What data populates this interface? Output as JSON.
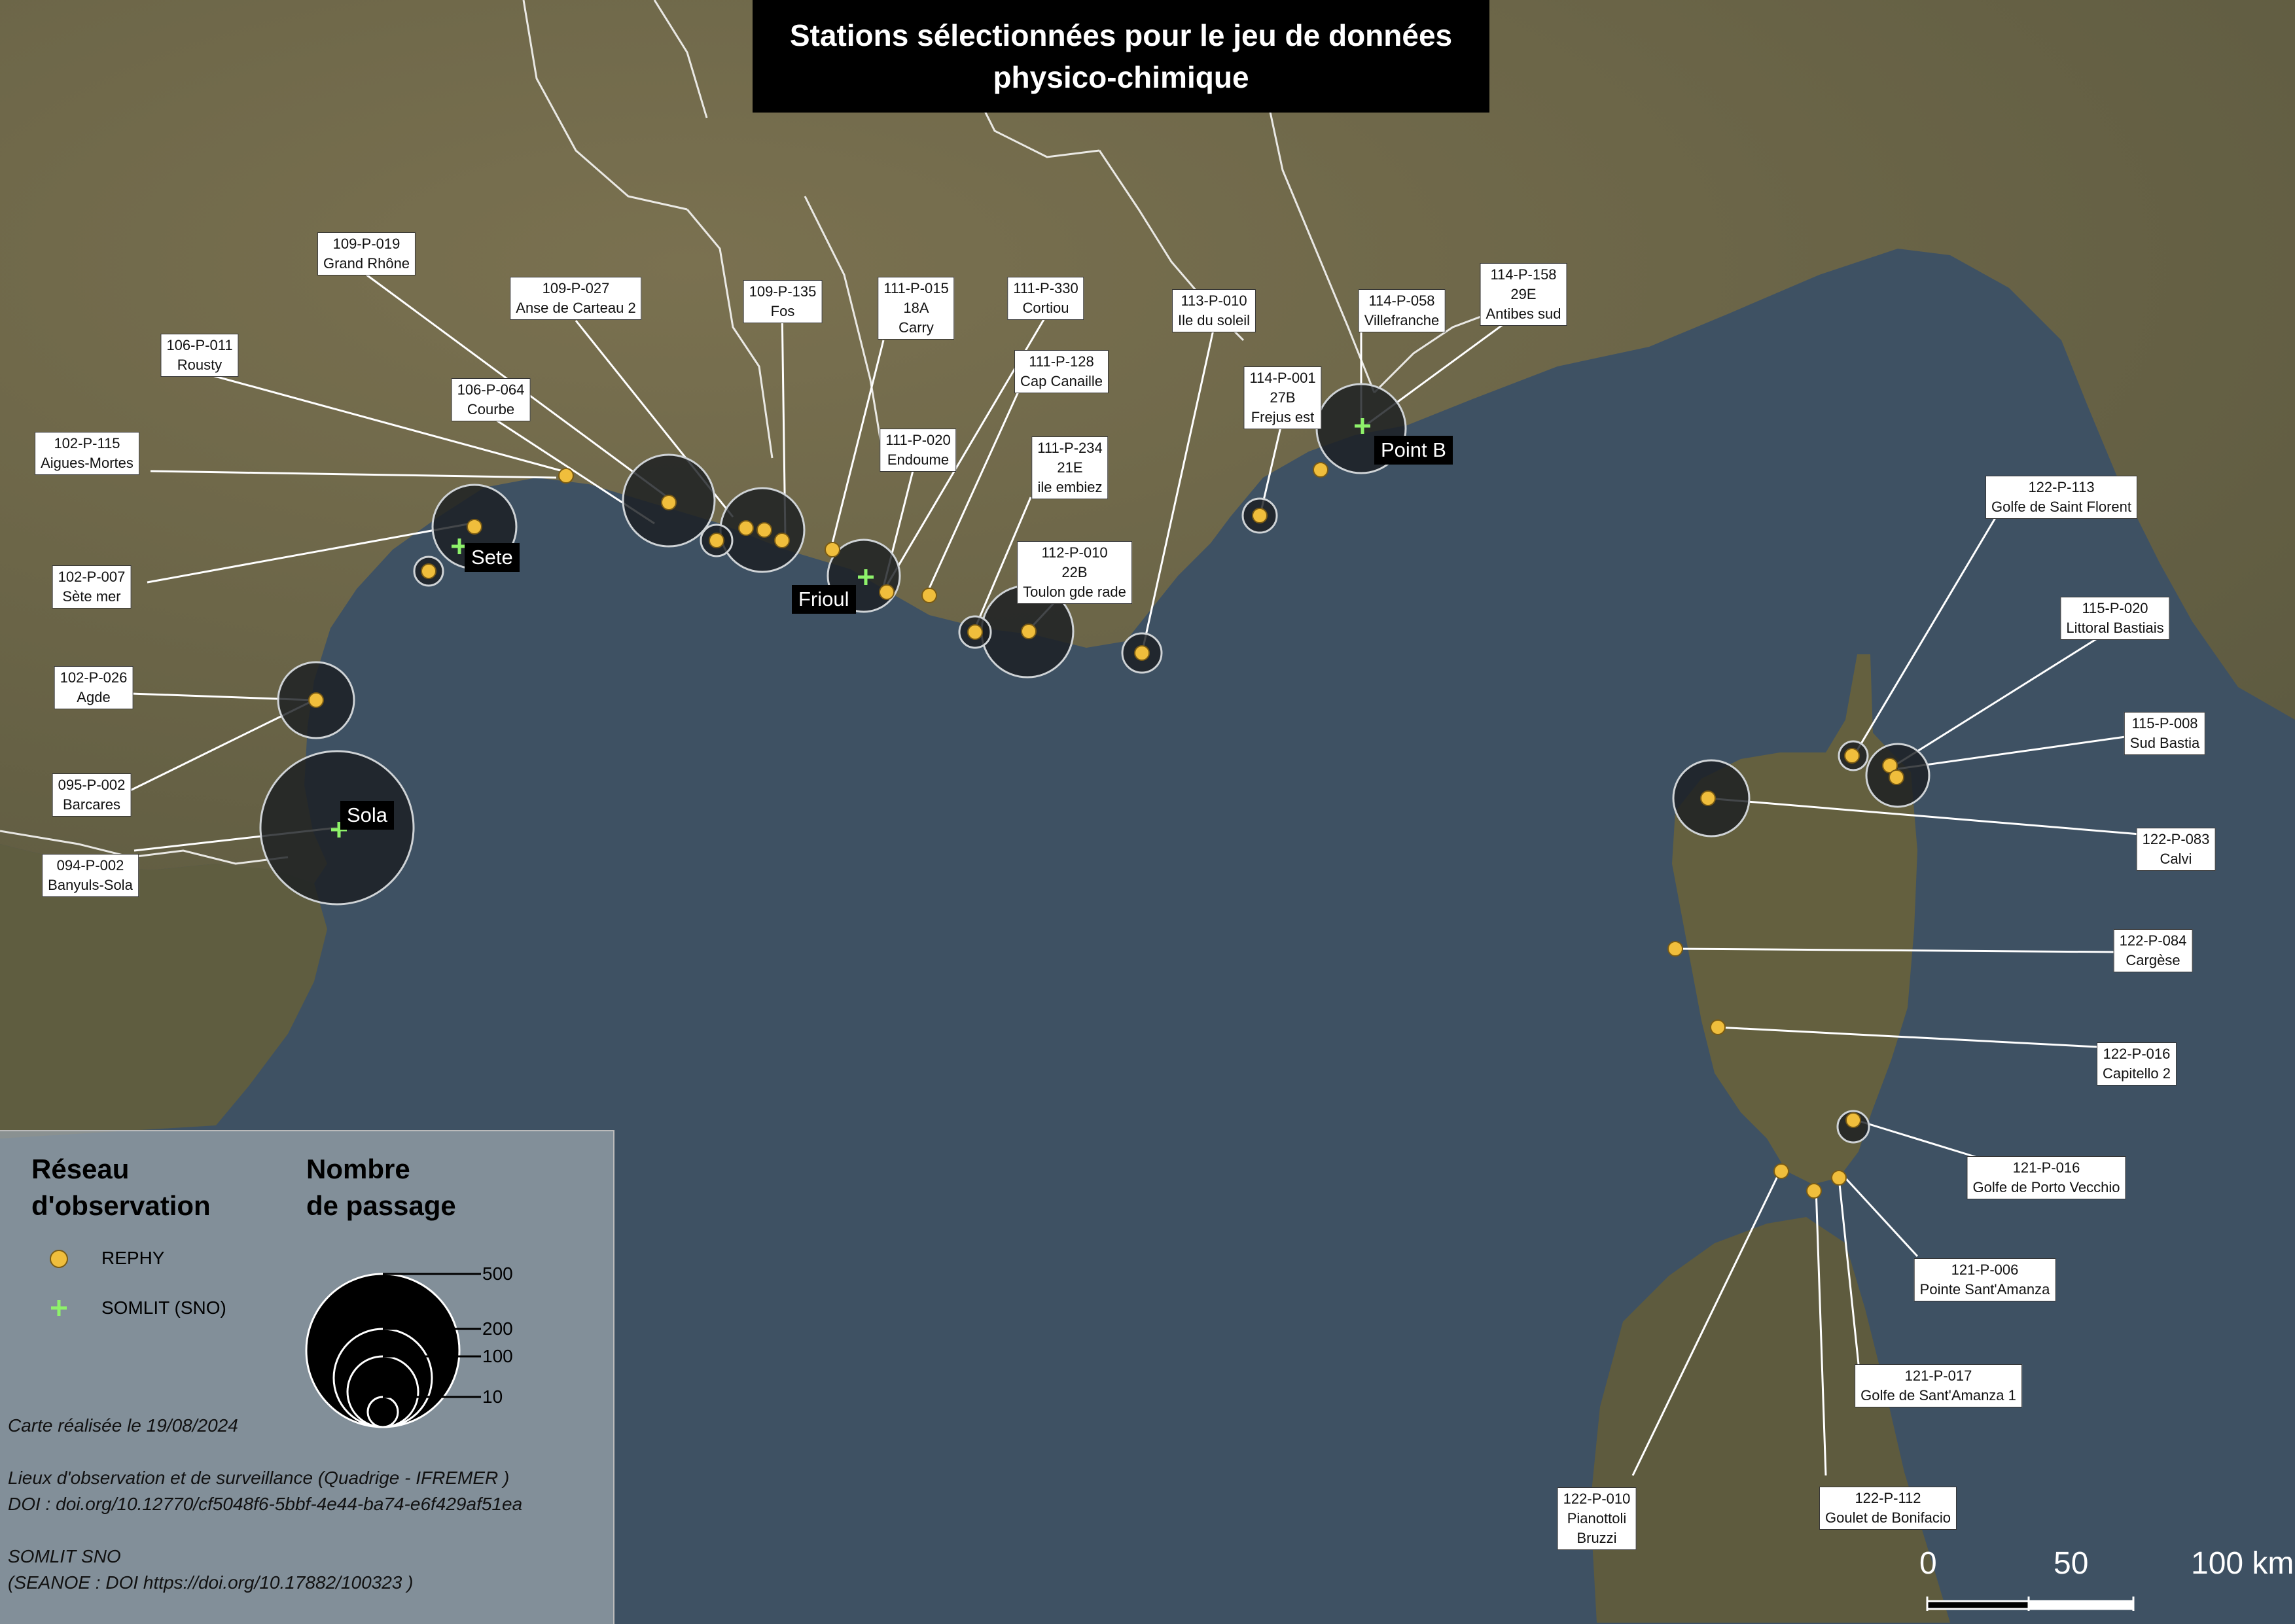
{
  "title": {
    "line1": "Stations sélectionnées pour le jeu de données",
    "line2": "physico-chimique"
  },
  "colors": {
    "sea": "#3e5163",
    "land": "#6f6648",
    "rephy": "#f0be3c",
    "somlit": "#8ef26a",
    "border": "#ffffff"
  },
  "station_labels": [
    {
      "l1": "109-P-019",
      "l2": "Grand Rhône"
    },
    {
      "l1": "109-P-027",
      "l2": "Anse de Carteau 2"
    },
    {
      "l1": "109-P-135",
      "l2": "Fos"
    },
    {
      "l1": "111-P-015",
      "l2": "18A",
      "l3": "Carry"
    },
    {
      "l1": "111-P-330",
      "l2": "Cortiou"
    },
    {
      "l1": "106-P-011",
      "l2": "Rousty"
    },
    {
      "l1": "106-P-064",
      "l2": "Courbe"
    },
    {
      "l1": "111-P-128",
      "l2": "Cap Canaille"
    },
    {
      "l1": "102-P-115",
      "l2": "Aigues-Mortes"
    },
    {
      "l1": "111-P-020",
      "l2": "Endoume"
    },
    {
      "l1": "111-P-234",
      "l2": "21E",
      "l3": "ile embiez"
    },
    {
      "l1": "102-P-007",
      "l2": "Sète mer"
    },
    {
      "l1": "112-P-010",
      "l2": "22B",
      "l3": "Toulon gde rade"
    },
    {
      "l1": "102-P-026",
      "l2": "Agde"
    },
    {
      "l1": "095-P-002",
      "l2": "Barcares"
    },
    {
      "l1": "094-P-002",
      "l2": "Banyuls-Sola"
    },
    {
      "l1": "113-P-010",
      "l2": "Ile du soleil"
    },
    {
      "l1": "114-P-001",
      "l2": "27B",
      "l3": "Frejus est"
    },
    {
      "l1": "114-P-058",
      "l2": "Villefranche"
    },
    {
      "l1": "114-P-158",
      "l2": "29E",
      "l3": "Antibes sud"
    },
    {
      "l1": "122-P-113",
      "l2": "Golfe de Saint Florent"
    },
    {
      "l1": "115-P-020",
      "l2": "Littoral Bastiais"
    },
    {
      "l1": "115-P-008",
      "l2": "Sud Bastia"
    },
    {
      "l1": "122-P-083",
      "l2": "Calvi"
    },
    {
      "l1": "122-P-084",
      "l2": "Cargèse"
    },
    {
      "l1": "122-P-016",
      "l2": "Capitello  2"
    },
    {
      "l1": "121-P-016",
      "l2": "Golfe de Porto Vecchio"
    },
    {
      "l1": "121-P-006",
      "l2": "Pointe Sant'Amanza"
    },
    {
      "l1": "121-P-017",
      "l2": "Golfe de Sant'Amanza 1"
    },
    {
      "l1": "122-P-010",
      "l2": "Pianottoli",
      "l3": "Bruzzi"
    },
    {
      "l1": "122-P-112",
      "l2": "Goulet de Bonifacio"
    }
  ],
  "somlit_labels": {
    "sete": "Sete",
    "frioul": "Frioul",
    "sola": "Sola",
    "point_b": "Point B"
  },
  "legend": {
    "network_title_l1": "Réseau",
    "network_title_l2": "d'observation",
    "passage_title_l1": "Nombre",
    "passage_title_l2": "de passage",
    "rephy": "REPHY",
    "somlit": "SOMLIT (SNO)",
    "sizes": [
      500,
      200,
      100,
      10
    ]
  },
  "credits": {
    "date": "Carte réalisée le 19/08/2024",
    "src1": "Lieux d'observation et de surveillance (Quadrige - IFREMER )",
    "doi1": "DOI : doi.org/10.12770/cf5048f6-5bbf-4e44-ba74-e6f429af51ea",
    "src2": "SOMLIT SNO",
    "doi2": "(SEANOE : DOI https://doi.org/10.17882/100323  )"
  },
  "scale": {
    "ticks": [
      "0",
      "50",
      "100 km"
    ]
  }
}
